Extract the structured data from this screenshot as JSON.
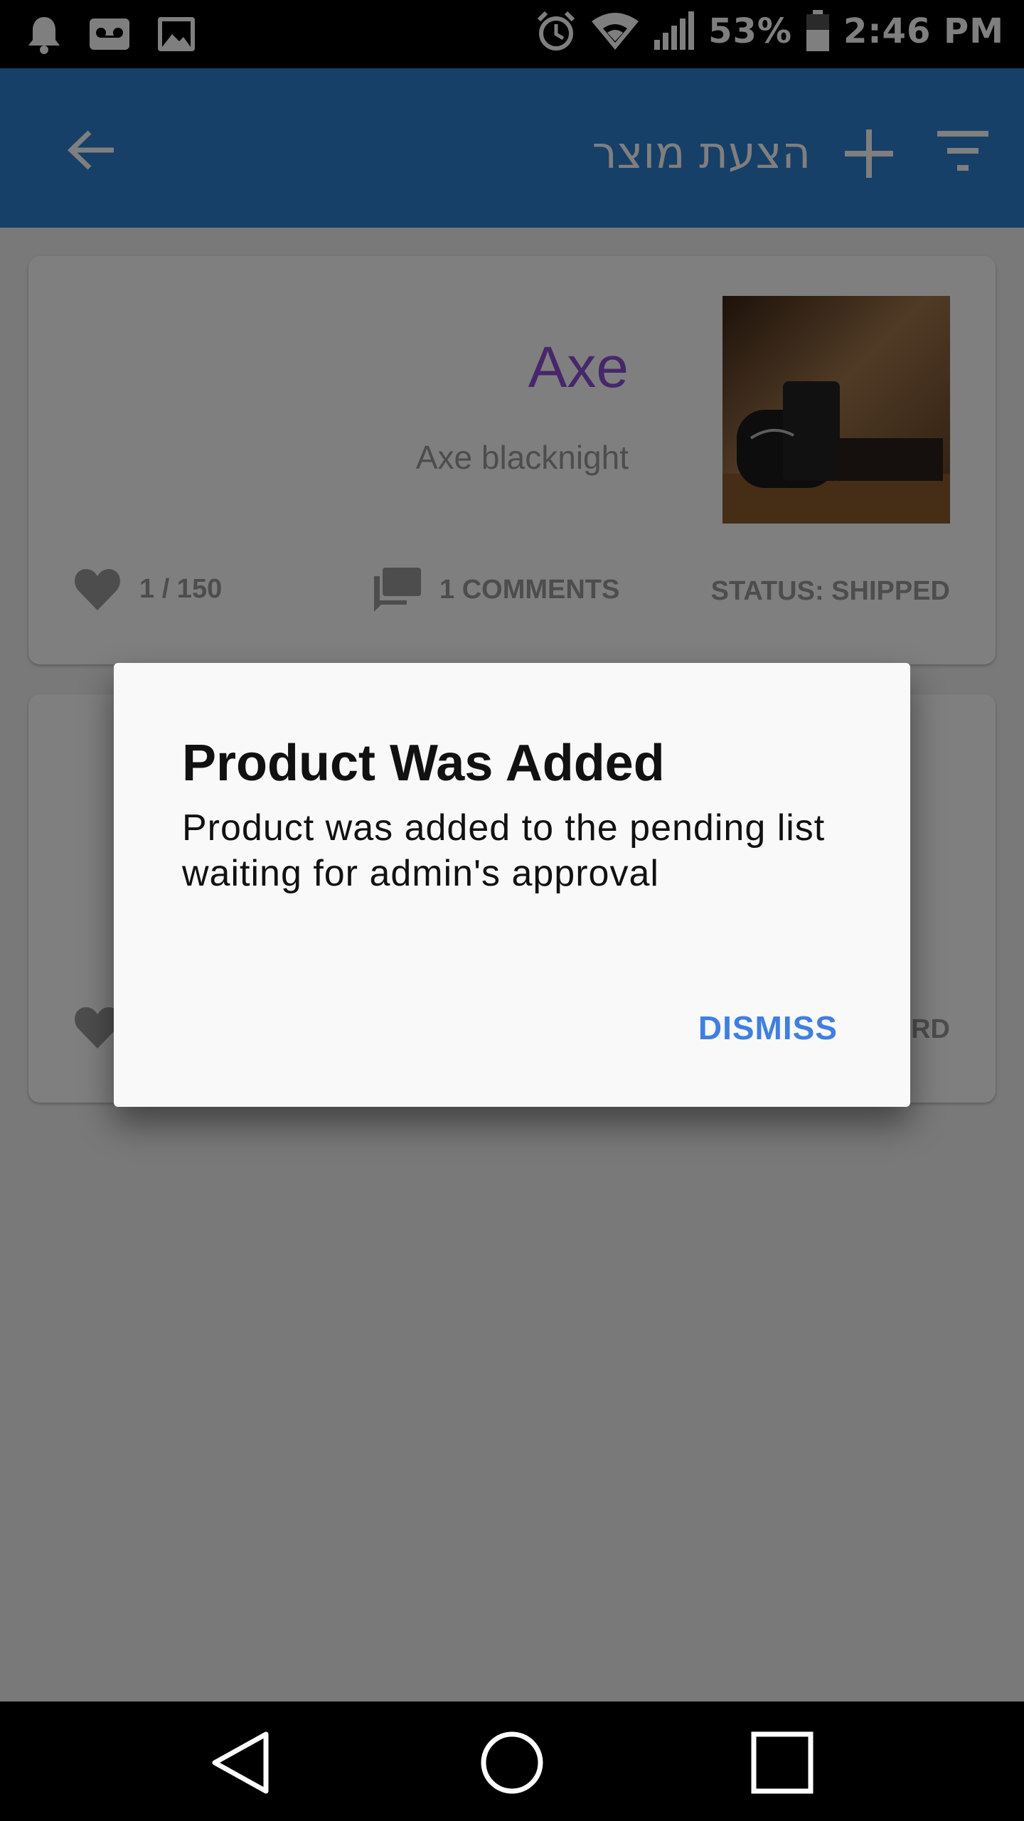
{
  "status_bar": {
    "battery": "53%",
    "time": "2:46 PM",
    "left_icons": [
      "bell-icon",
      "voicemail-icon",
      "image-icon"
    ],
    "right_icons": [
      "alarm-icon",
      "wifi-icon",
      "signal-icon",
      "battery-icon"
    ]
  },
  "app_bar": {
    "title": "הצעת מוצר",
    "back_icon": "arrow-left-icon",
    "add_icon": "plus-icon",
    "filter_icon": "filter-icon",
    "color": "#2f80d0"
  },
  "products": [
    {
      "name": "Axe",
      "description": "Axe blacknight",
      "likes": "1 / 150",
      "comments": "1 COMMENTS",
      "status": "STATUS: SHIPPED"
    },
    {
      "name": "",
      "description": "",
      "likes": "",
      "comments": "",
      "status": "ERD"
    }
  ],
  "dialog": {
    "title": "Product Was Added",
    "message": "Product was added to the pending list waiting for admin's approval",
    "dismiss_label": "DISMISS"
  },
  "nav_bar": {
    "icons": [
      "back-triangle-icon",
      "home-circle-icon",
      "recents-square-icon"
    ]
  },
  "colors": {
    "accent": "#3f7fe0",
    "product_name": "#8e4fd6"
  }
}
